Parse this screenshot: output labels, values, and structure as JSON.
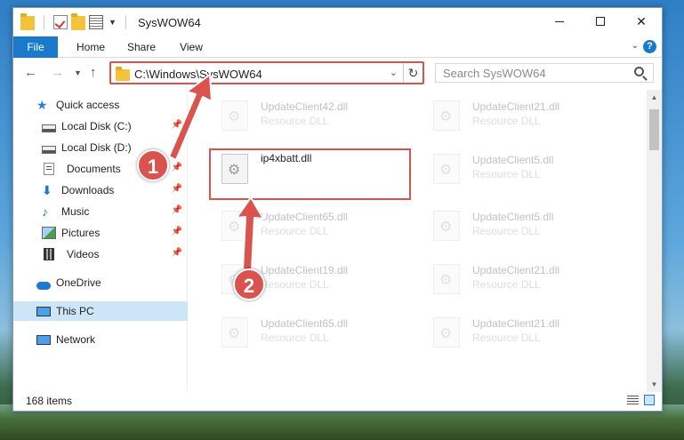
{
  "window": {
    "title": "SysWOW64",
    "accent": "#1979ca",
    "highlight_color": "#d9534f"
  },
  "ribbon": {
    "tabs": [
      {
        "label": "File"
      },
      {
        "label": "Home"
      },
      {
        "label": "Share"
      },
      {
        "label": "View"
      }
    ],
    "help": "?"
  },
  "nav": {
    "address": "C:\\Windows\\SysWOW64",
    "search_placeholder": "Search SysWOW64"
  },
  "sidebar": {
    "items": [
      {
        "label": "Quick access",
        "icon": "star-icon"
      },
      {
        "label": "Local Disk (C:)",
        "icon": "disk-icon"
      },
      {
        "label": "Local Disk (D:)",
        "icon": "disk-icon"
      },
      {
        "label": "Documents",
        "icon": "document-icon"
      },
      {
        "label": "Downloads",
        "icon": "download-icon"
      },
      {
        "label": "Music",
        "icon": "music-icon"
      },
      {
        "label": "Pictures",
        "icon": "pictures-icon"
      },
      {
        "label": "Videos",
        "icon": "videos-icon"
      },
      {
        "label": "OneDrive",
        "icon": "cloud-icon"
      },
      {
        "label": "This PC",
        "icon": "computer-icon"
      },
      {
        "label": "Network",
        "icon": "network-icon"
      }
    ]
  },
  "files": [
    {
      "name": "UpdateClient42.dll",
      "type": "Resource DLL"
    },
    {
      "name": "UpdateClient21.dll",
      "type": "Resource DLL"
    },
    {
      "name": "ip4xbatt.dll",
      "type": ""
    },
    {
      "name": "UpdateClient5.dll",
      "type": "Resource DLL"
    },
    {
      "name": "UpdateClient65.dll",
      "type": "Resource DLL"
    },
    {
      "name": "UpdateClient5.dll",
      "type": "Resource DLL"
    },
    {
      "name": "UpdateClient19.dll",
      "type": "Resource DLL"
    },
    {
      "name": "UpdateClient21.dll",
      "type": "Resource DLL"
    },
    {
      "name": "UpdateClient65.dll",
      "type": "Resource DLL"
    },
    {
      "name": "UpdateClient21.dll",
      "type": "Resource DLL"
    }
  ],
  "status": {
    "item_count": "168 items"
  },
  "annotations": {
    "step1": "1",
    "step2": "2"
  }
}
